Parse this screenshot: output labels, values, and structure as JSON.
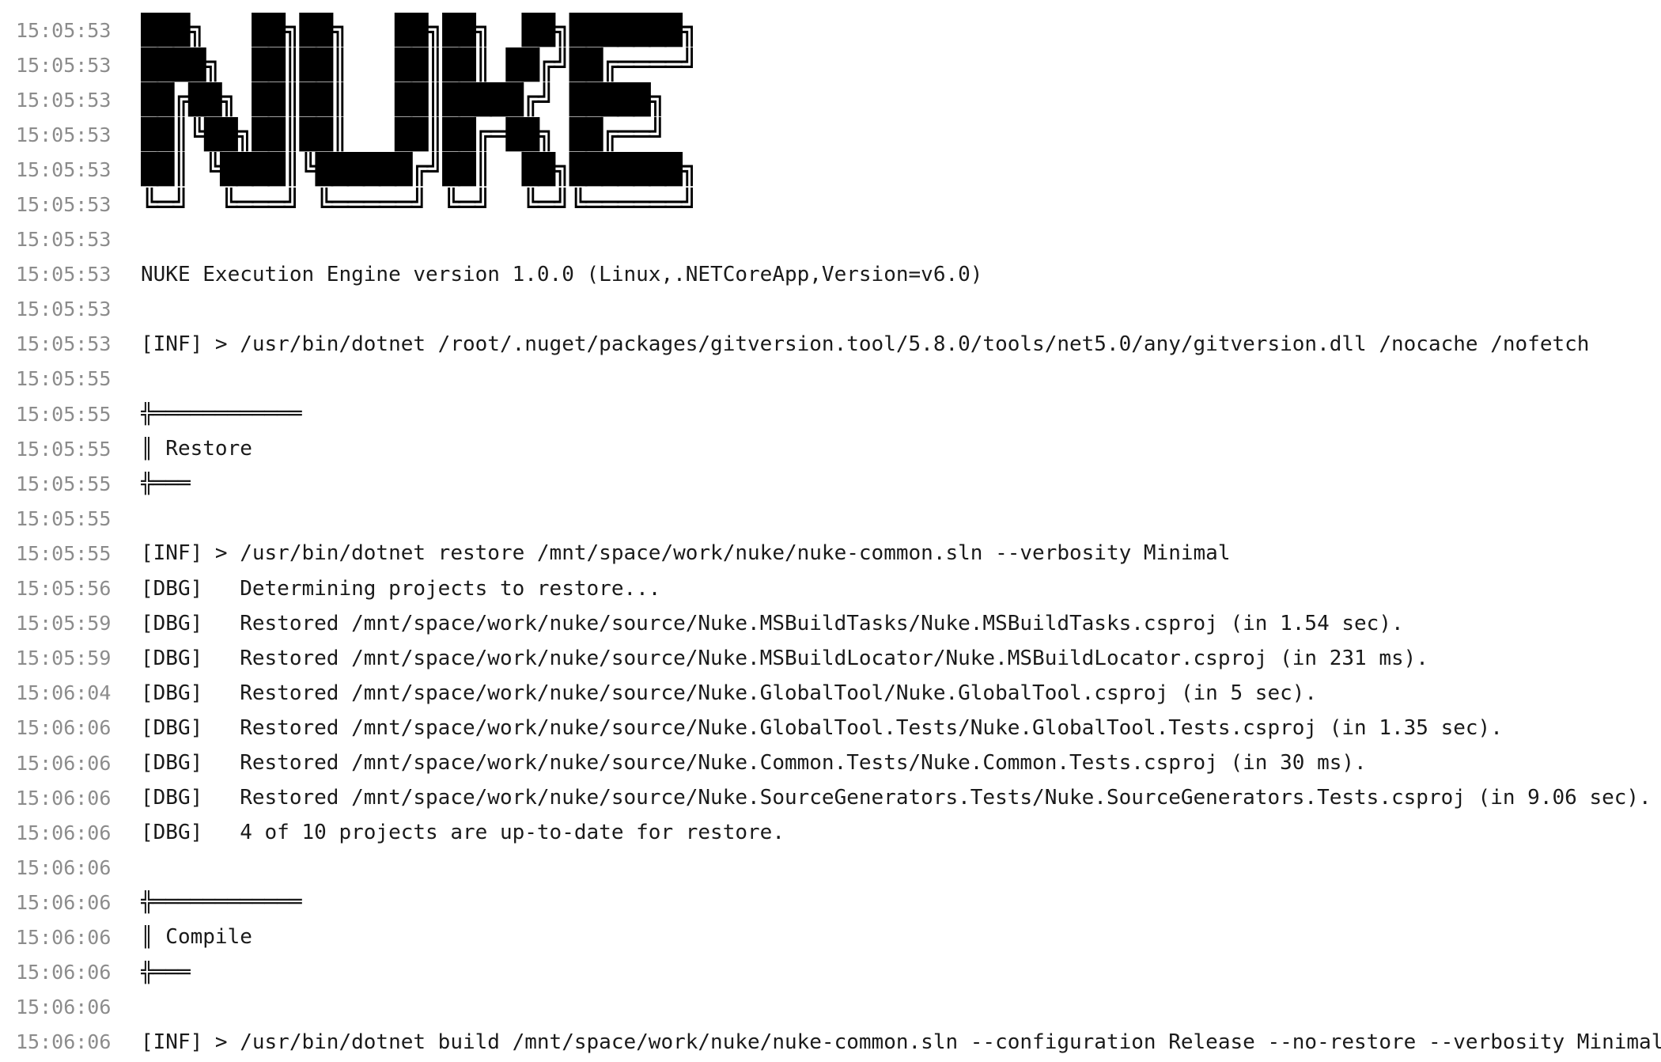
{
  "lines": [
    {
      "time": "15:05:53",
      "text": "███╗   ██╗██╗   ██╗██╗  ██╗███████╗",
      "kind": "banner"
    },
    {
      "time": "15:05:53",
      "text": "████╗  ██║██║   ██║██║ ██╔╝██╔════╝",
      "kind": "banner"
    },
    {
      "time": "15:05:53",
      "text": "██╔██╗ ██║██║   ██║█████╔╝ █████╗",
      "kind": "banner"
    },
    {
      "time": "15:05:53",
      "text": "██║╚██╗██║██║   ██║██╔═██╗ ██╔══╝",
      "kind": "banner"
    },
    {
      "time": "15:05:53",
      "text": "██║ ╚████║╚██████╔╝██║  ██╗███████╗",
      "kind": "banner"
    },
    {
      "time": "15:05:53",
      "text": "╚═╝  ╚═══╝ ╚═════╝ ╚═╝  ╚═╝╚══════╝",
      "kind": "banner"
    },
    {
      "time": "15:05:53",
      "text": ""
    },
    {
      "time": "15:05:53",
      "text": "NUKE Execution Engine version 1.0.0 (Linux,.NETCoreApp,Version=v6.0)"
    },
    {
      "time": "15:05:53",
      "text": ""
    },
    {
      "time": "15:05:53",
      "text": "[INF] > /usr/bin/dotnet /root/.nuget/packages/gitversion.tool/5.8.0/tools/net5.0/any/gitversion.dll /nocache /nofetch"
    },
    {
      "time": "15:05:55",
      "text": ""
    },
    {
      "time": "15:05:55",
      "text": "╬════════════",
      "kind": "box"
    },
    {
      "time": "15:05:55",
      "text": "║ Restore",
      "kind": "box"
    },
    {
      "time": "15:05:55",
      "text": "╬═══",
      "kind": "box"
    },
    {
      "time": "15:05:55",
      "text": ""
    },
    {
      "time": "15:05:55",
      "text": "[INF] > /usr/bin/dotnet restore /mnt/space/work/nuke/nuke-common.sln --verbosity Minimal"
    },
    {
      "time": "15:05:56",
      "text": "[DBG]   Determining projects to restore..."
    },
    {
      "time": "15:05:59",
      "text": "[DBG]   Restored /mnt/space/work/nuke/source/Nuke.MSBuildTasks/Nuke.MSBuildTasks.csproj (in 1.54 sec)."
    },
    {
      "time": "15:05:59",
      "text": "[DBG]   Restored /mnt/space/work/nuke/source/Nuke.MSBuildLocator/Nuke.MSBuildLocator.csproj (in 231 ms)."
    },
    {
      "time": "15:06:04",
      "text": "[DBG]   Restored /mnt/space/work/nuke/source/Nuke.GlobalTool/Nuke.GlobalTool.csproj (in 5 sec)."
    },
    {
      "time": "15:06:06",
      "text": "[DBG]   Restored /mnt/space/work/nuke/source/Nuke.GlobalTool.Tests/Nuke.GlobalTool.Tests.csproj (in 1.35 sec)."
    },
    {
      "time": "15:06:06",
      "text": "[DBG]   Restored /mnt/space/work/nuke/source/Nuke.Common.Tests/Nuke.Common.Tests.csproj (in 30 ms)."
    },
    {
      "time": "15:06:06",
      "text": "[DBG]   Restored /mnt/space/work/nuke/source/Nuke.SourceGenerators.Tests/Nuke.SourceGenerators.Tests.csproj (in 9.06 sec)."
    },
    {
      "time": "15:06:06",
      "text": "[DBG]   4 of 10 projects are up-to-date for restore."
    },
    {
      "time": "15:06:06",
      "text": ""
    },
    {
      "time": "15:06:06",
      "text": "╬════════════",
      "kind": "box"
    },
    {
      "time": "15:06:06",
      "text": "║ Compile",
      "kind": "box"
    },
    {
      "time": "15:06:06",
      "text": "╬═══",
      "kind": "box"
    },
    {
      "time": "15:06:06",
      "text": ""
    },
    {
      "time": "15:06:06",
      "text": "[INF] > /usr/bin/dotnet build /mnt/space/work/nuke/nuke-common.sln --configuration Release --no-restore --verbosity Minimal"
    }
  ]
}
